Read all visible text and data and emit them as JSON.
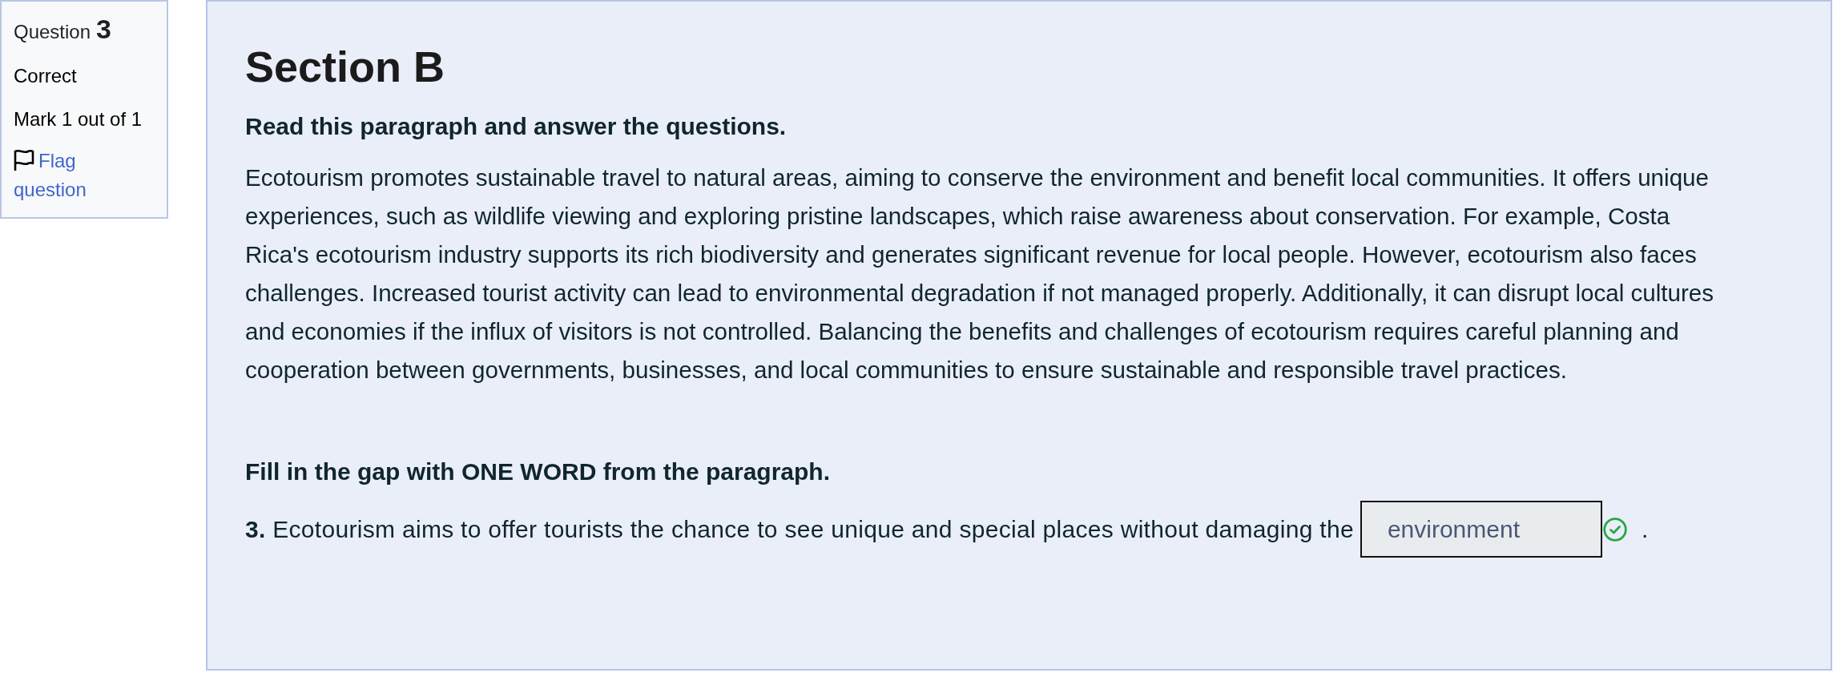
{
  "question_info": {
    "label": "Question",
    "number": "3",
    "state": "Correct",
    "grade": "Mark 1 out of 1",
    "flag_link": "Flag question",
    "flagged": false
  },
  "section": {
    "title": "Section B",
    "instruction": "Read this paragraph and answer the questions.",
    "paragraph_lines": [
      "Ecotourism promotes sustainable travel to natural areas, aiming to conserve the environment and benefit local communities. It offers unique",
      "experiences, such as wildlife viewing and exploring pristine landscapes, which raise awareness about conservation. For example, Costa",
      "Rica's ecotourism industry supports its rich biodiversity and generates significant revenue for local people. However, ecotourism also faces",
      "challenges. Increased tourist activity can lead to environmental degradation if not managed properly. Additionally, it can disrupt local cultures",
      "and economies if the influx of visitors is not controlled. Balancing the benefits and challenges of ecotourism requires careful planning and",
      "cooperation between governments, businesses, and local communities to ensure sustainable and responsible travel practices."
    ],
    "task": "Fill in the gap with ONE WORD from the paragraph.",
    "question": {
      "text": "**3.** Ecotourism aims to offer tourists the chance to see unique and special places without damaging the",
      "answer": "environment",
      "correct": true,
      "after": "."
    }
  }
}
